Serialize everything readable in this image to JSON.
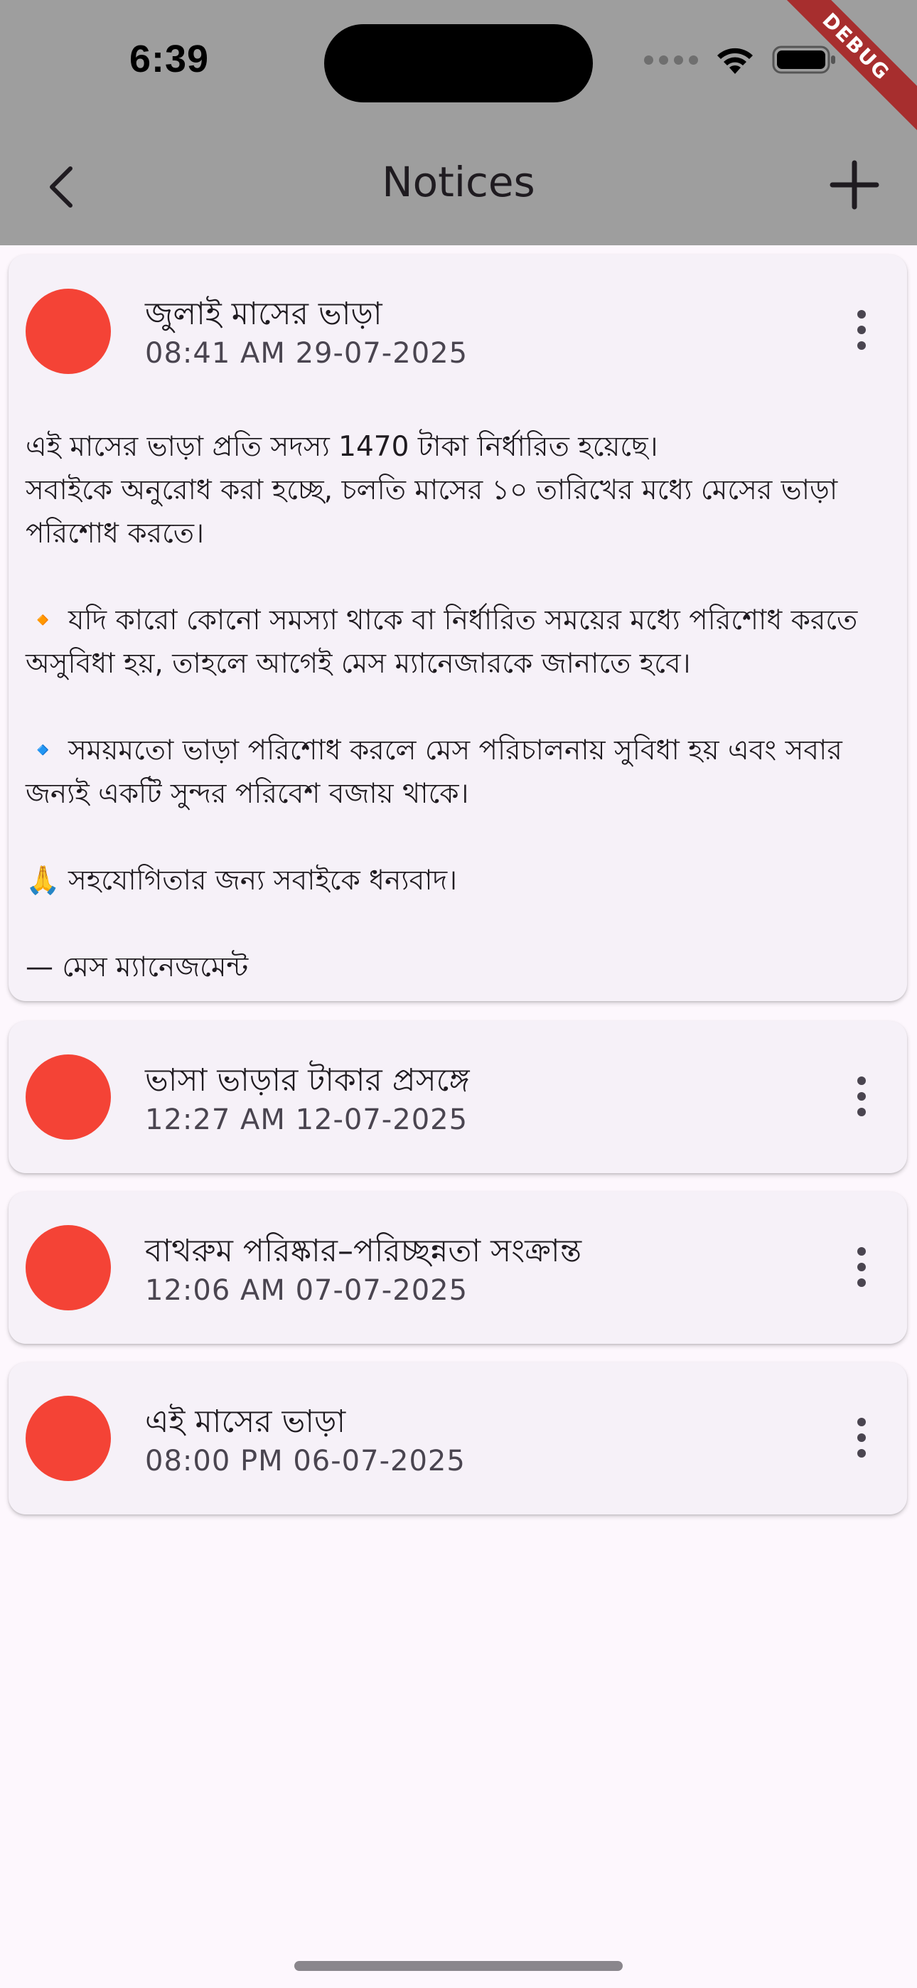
{
  "status_bar": {
    "time": "6:39"
  },
  "debug_banner": "DEBUG",
  "app_bar": {
    "title": "Notices",
    "back_icon": "chevron-left-icon",
    "add_icon": "plus-icon"
  },
  "colors": {
    "app_bar_bg": "#9e9e9e",
    "avatar": "#f44336",
    "card_bg": "#f6f1f8",
    "page_bg": "#fdf7fd"
  },
  "notices": [
    {
      "title": "জুলাই মাসের ভাড়া",
      "datetime": "08:41 AM 29-07-2025",
      "expanded": true,
      "body": {
        "line1": "এই মাসের ভাড়া প্রতি সদস্য 1470 টাকা নির্ধারিত হয়েছে।",
        "line2": "সবাইকে অনুরোধ করা হচ্ছে, চলতি মাসের ১০ তারিখের মধ্যে মেসের ভাড়া পরিশোধ করতে।",
        "item1_icon": "🔸",
        "item1": "যদি কারো কোনো সমস্যা থাকে বা নির্ধারিত সময়ের মধ্যে পরিশোধ করতে অসুবিধা হয়, তাহলে আগেই মেস ম্যানেজারকে জানাতে হবে।",
        "item2_icon": "🔹",
        "item2": "সময়মতো ভাড়া পরিশোধ করলে মেস পরিচালনায় সুবিধা হয় এবং সবার জন্যই একটি সুন্দর পরিবেশ বজায় থাকে।",
        "item3_icon": "🙏",
        "item3": "সহযোগিতার জন্য সবাইকে ধন্যবাদ।",
        "signature": "— মেস ম্যানেজমেন্ট"
      }
    },
    {
      "title": "ভাসা ভাড়ার টাকার প্রসঙ্গে",
      "datetime": "12:27 AM 12-07-2025"
    },
    {
      "title": "বাথরুম পরিষ্কার–পরিচ্ছন্নতা সংক্রান্ত",
      "datetime": "12:06 AM 07-07-2025"
    },
    {
      "title": "এই মাসের ভাড়া",
      "datetime": "08:00 PM 06-07-2025"
    }
  ]
}
